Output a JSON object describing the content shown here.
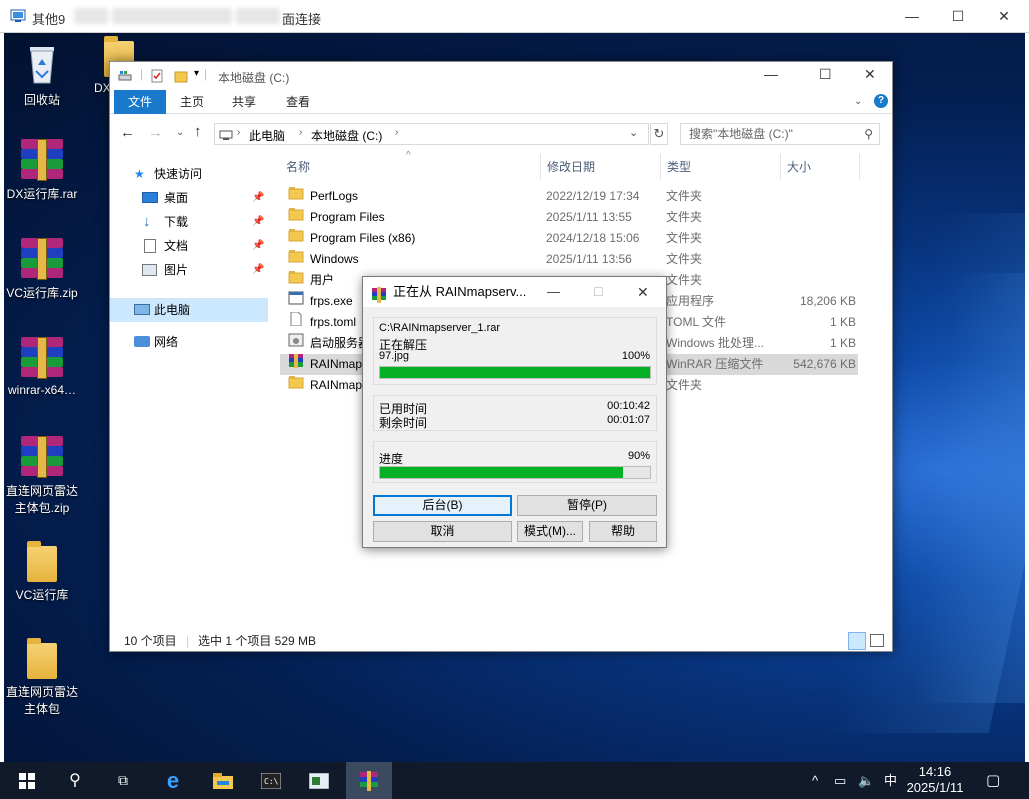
{
  "rdp_window": {
    "title": "其他9.… - … 远程桌面连接",
    "title_visible_left": "其他9",
    "title_visible_right": "面连接",
    "controls": {
      "minimize": "—",
      "maximize": "☐",
      "close": "✕"
    }
  },
  "desktop": {
    "icons": [
      {
        "label": "回收站",
        "icon": "recycle-bin-icon"
      },
      {
        "label": "DX",
        "icon": "folder-icon"
      },
      {
        "label": "DX运行库.rar",
        "icon": "winrar-archive-icon"
      },
      {
        "label": "VC运行库.zip",
        "icon": "winrar-archive-icon"
      },
      {
        "label": "winrar-x64…",
        "icon": "winrar-archive-icon"
      },
      {
        "label": "直连网页雷达主体包.zip",
        "line1": "直连网页雷达",
        "line2": "主体包.zip",
        "icon": "winrar-archive-icon"
      },
      {
        "label": "VC运行库",
        "icon": "folder-icon"
      },
      {
        "label": "直连网页雷达主体包",
        "line1": "直连网页雷达",
        "line2": "主体包",
        "icon": "folder-icon"
      }
    ]
  },
  "explorer": {
    "title": "本地磁盘 (C:)",
    "tabs": [
      "文件",
      "主页",
      "共享",
      "查看"
    ],
    "active_tab": "文件",
    "breadcrumb": [
      "此电脑",
      "本地磁盘 (C:)"
    ],
    "search_placeholder": "搜索\"本地磁盘 (C:)\"",
    "nav": {
      "quick_access": "快速访问",
      "items": [
        "桌面",
        "下载",
        "文档",
        "图片"
      ],
      "this_pc": "此电脑",
      "network": "网络"
    },
    "columns": [
      "名称",
      "修改日期",
      "类型",
      "大小"
    ],
    "files": [
      {
        "name": "PerfLogs",
        "date": "2022/12/19 17:34",
        "type": "文件夹",
        "size": "",
        "icon": "folder-icon"
      },
      {
        "name": "Program Files",
        "date": "2025/1/11 13:55",
        "type": "文件夹",
        "size": "",
        "icon": "folder-icon"
      },
      {
        "name": "Program Files (x86)",
        "date": "2024/12/18 15:06",
        "type": "文件夹",
        "size": "",
        "icon": "folder-icon"
      },
      {
        "name": "Windows",
        "date": "2025/1/11 13:56",
        "type": "文件夹",
        "size": "",
        "icon": "folder-icon"
      },
      {
        "name": "用户",
        "date": "",
        "type": "文件夹",
        "size": "",
        "icon": "folder-icon"
      },
      {
        "name": "frps.exe",
        "date": "",
        "type": "应用程序",
        "size": "18,206 KB",
        "icon": "exe-icon"
      },
      {
        "name": "frps.toml",
        "date": "",
        "type": "TOML 文件",
        "size": "1 KB",
        "icon": "file-icon"
      },
      {
        "name": "启动服务器",
        "date": "",
        "type": "Windows 批处理...",
        "size": "1 KB",
        "icon": "batch-icon"
      },
      {
        "name": "RAINmap",
        "date": "",
        "type": "WinRAR 压缩文件",
        "size": "542,676 KB",
        "icon": "winrar-archive-icon"
      },
      {
        "name": "RAINmap",
        "date": "",
        "type": "文件夹",
        "size": "",
        "icon": "folder-icon"
      }
    ],
    "status_count": "10 个项目",
    "status_selected": "选中 1 个项目  529 MB"
  },
  "winrar_dialog": {
    "title": "正在从 RAINmapserv...",
    "archive_path": "C:\\RAINmapserver_1.rar",
    "action": "正在解压",
    "current_file": "97.jpg",
    "file_percent_text": "100%",
    "file_progress": 1.0,
    "elapsed_label": "已用时间",
    "elapsed_value": "00:10:42",
    "remaining_label": "剩余时间",
    "remaining_value": "00:01:07",
    "progress_label": "进度",
    "total_percent_text": "90%",
    "total_progress": 0.9,
    "buttons": {
      "background": "后台(B)",
      "pause": "暂停(P)",
      "cancel": "取消",
      "mode": "模式(M)...",
      "help": "帮助"
    },
    "progress_color": "#06b025"
  },
  "taskbar": {
    "clock_time": "14:16",
    "clock_date": "2025/1/11",
    "ime": "中",
    "accent": "#101a2b"
  }
}
